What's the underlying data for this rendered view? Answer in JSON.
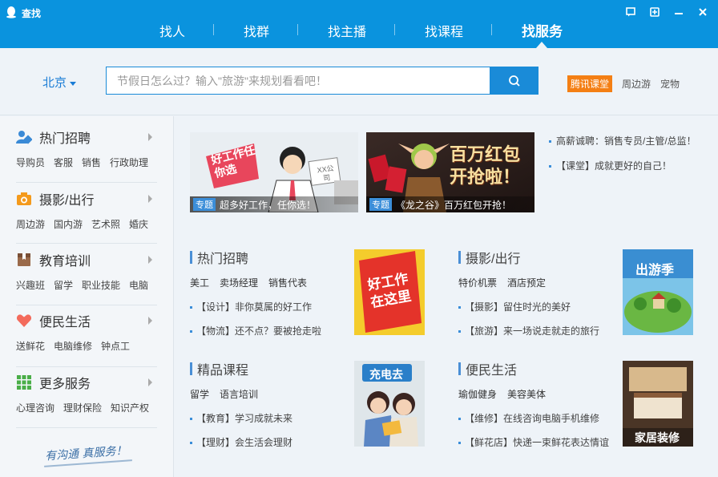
{
  "window": {
    "title": "查找",
    "btn_feedback": "⚑",
    "btn_min": "−",
    "btn_close": "✕"
  },
  "nav": {
    "tabs": [
      {
        "label": "找人"
      },
      {
        "label": "找群"
      },
      {
        "label": "找主播"
      },
      {
        "label": "找课程"
      },
      {
        "label": "找服务"
      }
    ],
    "active": "找服务"
  },
  "search": {
    "city": "北京",
    "placeholder": "节假日怎么过？输入\"旅游\"来规划看看吧！",
    "hot_badge": "腾讯课堂",
    "hot_links": [
      "周边游",
      "宠物"
    ]
  },
  "sidebar": {
    "categories": [
      {
        "title": "热门招聘",
        "links": [
          "导购员",
          "客服",
          "销售",
          "行政助理"
        ]
      },
      {
        "title": "摄影/出行",
        "links": [
          "周边游",
          "国内游",
          "艺术照",
          "婚庆"
        ]
      },
      {
        "title": "教育培训",
        "links": [
          "兴趣班",
          "留学",
          "职业技能",
          "电脑"
        ]
      },
      {
        "title": "便民生活",
        "links": [
          "送鲜花",
          "电脑维修",
          "钟点工"
        ]
      },
      {
        "title": "更多服务",
        "links": [
          "心理咨询",
          "理财保险",
          "知识产权"
        ]
      }
    ],
    "slogan": "有沟通 真服务！"
  },
  "banners": [
    {
      "tag": "专题",
      "text": "超多好工作，任你选！",
      "art_text": "好工作任你选",
      "art_sub": "XX公司"
    },
    {
      "tag": "专题",
      "text": "《龙之谷》百万红包开抢！",
      "art_text": "百万红包开抢啦！"
    }
  ],
  "news": [
    "高薪诚聘：销售专员/主管/总监！",
    "【课堂】成就更好的自己！"
  ],
  "sections": {
    "recruit": {
      "title": "热门招聘",
      "tags": [
        "美工",
        "卖场经理",
        "销售代表"
      ],
      "items": [
        "【设计】非你莫属的好工作",
        "【物流】还不点？要被抢走啦"
      ],
      "img_text": "好工作在这里"
    },
    "travel": {
      "title": "摄影/出行",
      "tags": [
        "特价机票",
        "酒店预定"
      ],
      "items": [
        "【摄影】留住时光的美好",
        "【旅游】来一场说走就走的旅行"
      ],
      "img_text": "出游季"
    },
    "course": {
      "title": "精品课程",
      "tags": [
        "留学",
        "语言培训"
      ],
      "items": [
        "【教育】学习成就未来",
        "【理财】会生活会理财"
      ],
      "img_text": "充电去"
    },
    "life": {
      "title": "便民生活",
      "tags": [
        "瑜伽健身",
        "美容美体"
      ],
      "items": [
        "【维修】在线咨询电脑手机维修",
        "【鲜花店】快递一束鲜花表达情谊"
      ],
      "img_text": "家居装修"
    }
  },
  "colors": {
    "titlebar": "#0a93de",
    "accent": "#1a8bd8",
    "badge": "#f47f14"
  }
}
